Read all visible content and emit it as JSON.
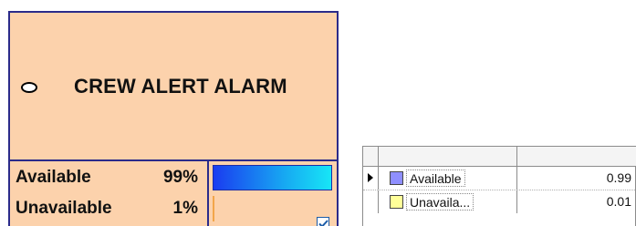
{
  "node": {
    "title": "CREW ALERT ALARM",
    "states": [
      {
        "label": "Available",
        "percent_text": "99%",
        "probability": 0.99
      },
      {
        "label": "Unavailable",
        "percent_text": "1%",
        "probability": 0.01
      }
    ],
    "checkbox_checked": true,
    "colors": {
      "background": "#fcd2ac",
      "border": "#2b2b8a",
      "available_bar": "#17a8f2",
      "unavailable_bar": "#f2a64a"
    }
  },
  "grid": {
    "rows": [
      {
        "name": "Available",
        "value": "0.99",
        "swatch_color": "#8f8fff",
        "selected": true
      },
      {
        "name": "Unavaila...",
        "value": "0.01",
        "swatch_color": "#ffff99",
        "selected": false
      }
    ]
  }
}
